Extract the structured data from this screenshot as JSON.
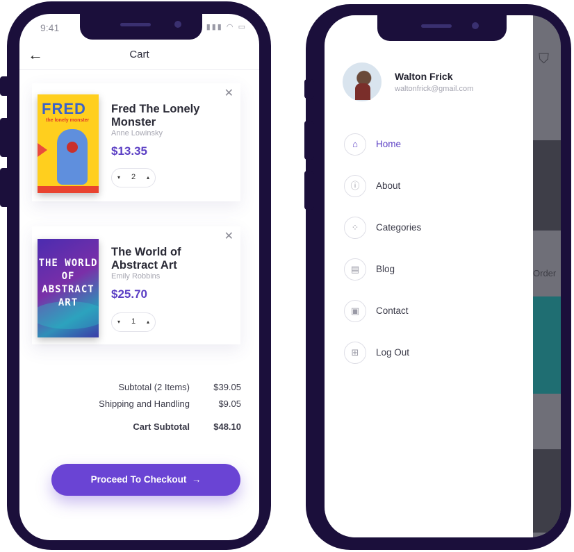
{
  "cart_screen": {
    "status_time": "9:41",
    "header_title": "Cart",
    "items": [
      {
        "title": "Fred The Lonely Monster",
        "author": "Anne Lowinsky",
        "price": "$13.35",
        "quantity": "2",
        "cover_title": "FRED",
        "cover_subtitle": "the lonely monster"
      },
      {
        "title": "The World of Abstract Art",
        "author": "Emily Robbins",
        "price": "$25.70",
        "quantity": "1",
        "cover_title": "THE WORLD OF ABSTRACT ART"
      }
    ],
    "summary": {
      "subtotal_label": "Subtotal (2 Items)",
      "subtotal_value": "$39.05",
      "shipping_label": "Shipping and Handling",
      "shipping_value": "$9.05",
      "total_label": "Cart Subtotal",
      "total_value": "$48.10"
    },
    "checkout_label": "Proceed To Checkout",
    "accent_color": "#6a44d4"
  },
  "menu_screen": {
    "profile": {
      "name": "Walton Frick",
      "email": "waltonfrick@gmail.com"
    },
    "items": [
      {
        "label": "Home",
        "icon": "home-icon",
        "active": true
      },
      {
        "label": "About",
        "icon": "info-icon",
        "active": false
      },
      {
        "label": "Categories",
        "icon": "categories-icon",
        "active": false
      },
      {
        "label": "Blog",
        "icon": "blog-icon",
        "active": false
      },
      {
        "label": "Contact",
        "icon": "contact-icon",
        "active": false
      },
      {
        "label": "Log Out",
        "icon": "logout-icon",
        "active": false
      }
    ],
    "background_peek_text": "Order"
  }
}
